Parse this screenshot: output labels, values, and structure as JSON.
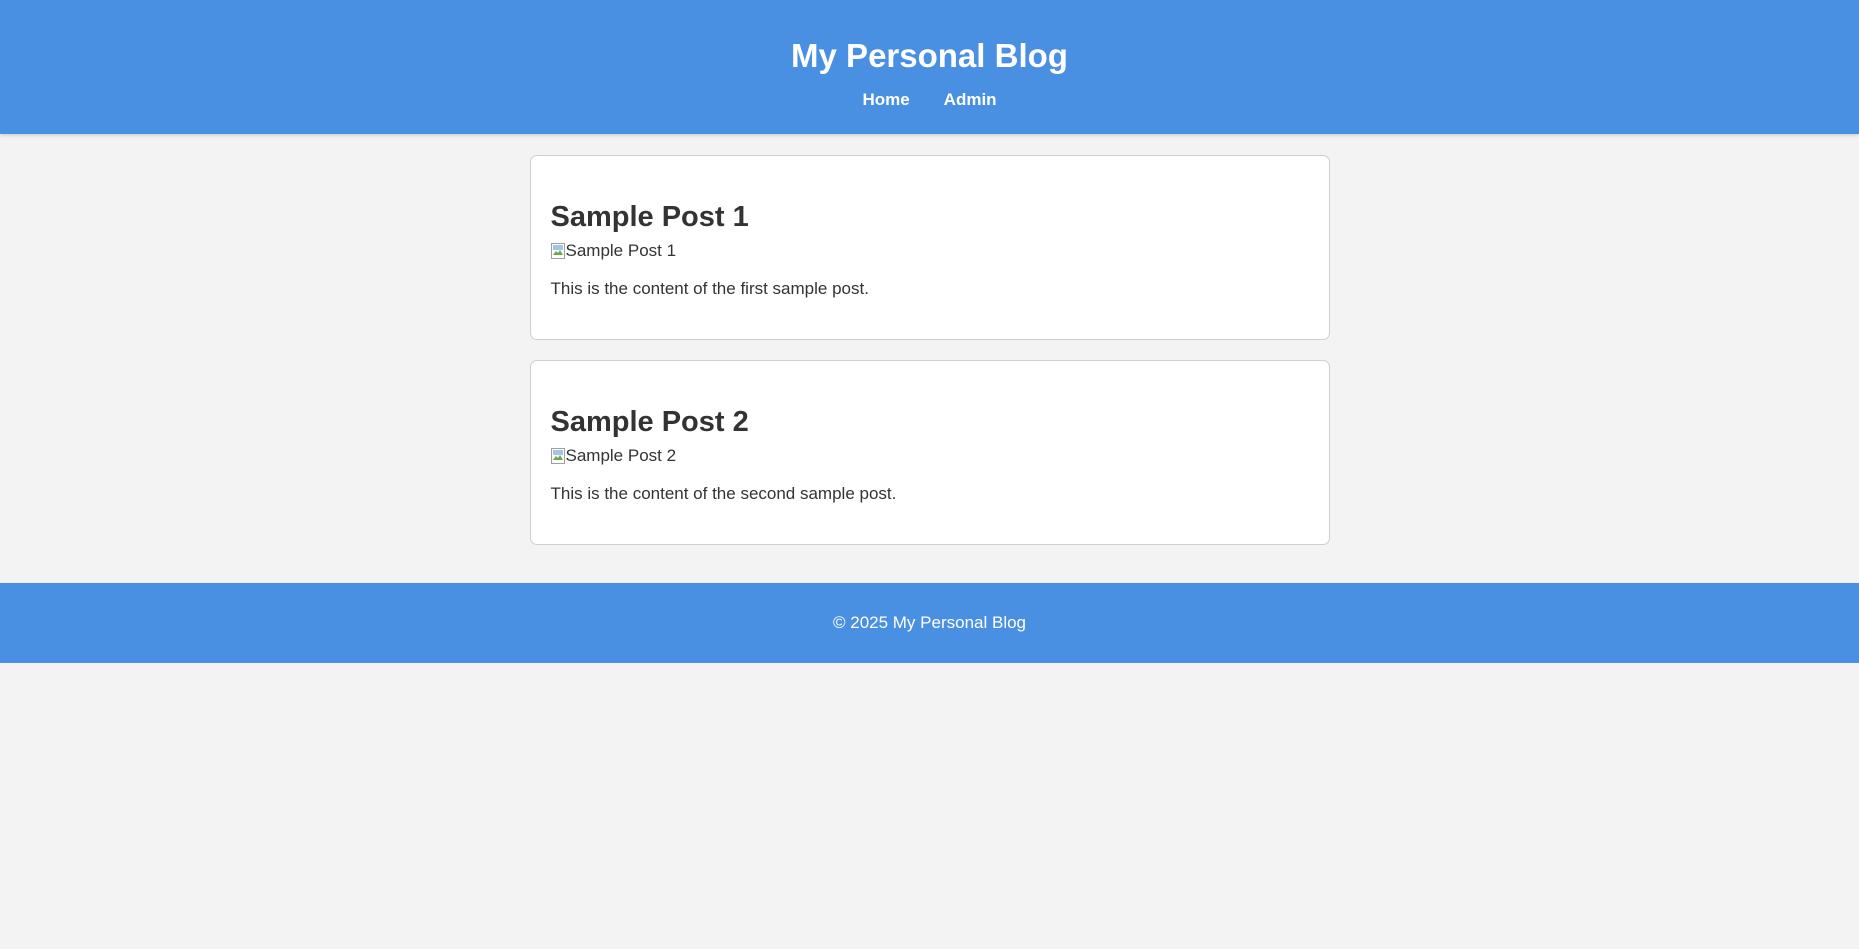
{
  "header": {
    "title": "My Personal Blog",
    "nav": [
      {
        "label": "Home"
      },
      {
        "label": "Admin"
      }
    ]
  },
  "posts": [
    {
      "title": "Sample Post 1",
      "image_alt": "Sample Post 1",
      "content": "This is the content of the first sample post."
    },
    {
      "title": "Sample Post 2",
      "image_alt": "Sample Post 2",
      "content": "This is the content of the second sample post."
    }
  ],
  "footer": {
    "text": "© 2025 My Personal Blog"
  },
  "colors": {
    "brand": "#4a90e2",
    "background": "#f3f3f3",
    "card": "#ffffff",
    "text": "#333333"
  }
}
